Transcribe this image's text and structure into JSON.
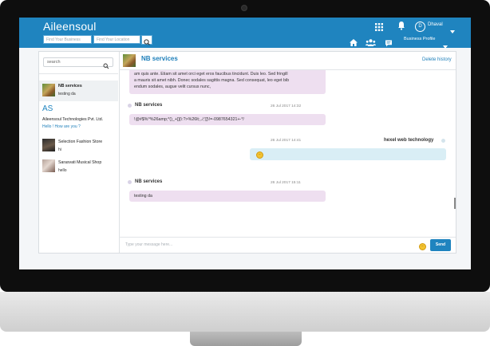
{
  "header": {
    "logo": "Aileensoul",
    "search_business_placeholder": "Find Your Business",
    "search_location_placeholder": "Find Your Location",
    "user_initial": "D",
    "user_name": "Dhaval",
    "business_profile": "Business Profile"
  },
  "sidebar": {
    "search_placeholder": "search",
    "conversations": [
      {
        "name": "NB services",
        "message": "testing da"
      },
      {
        "name": "Aileensoul Technologies Pvt. Ltd.",
        "message": "Hello ! How are you ?",
        "logo_text": "AS"
      },
      {
        "name": "Selection Fashion Store",
        "message": "hi"
      },
      {
        "name": "Sarasvati Musical Shop",
        "message": "hello"
      }
    ]
  },
  "chat": {
    "title": "NB services",
    "delete_history": "Delete history",
    "messages": [
      {
        "line1": "am quis ante. Etiam sit amet orci eget eros faucibus tincidunt. Duis leo. Sed fringill",
        "line2": "a mauris sit amet nibh. Donec sodales sagittis magna. Sed consequat, leo eget bib",
        "line3": "endum sodales, augue velit cursus nunc,"
      },
      {
        "sender": "NB services",
        "time": "26 Jul 2017 14:32",
        "text": "!@#$%^%26amp;*()_+[]{\\:?>%26lt;,./;'[]\\!=-0987654321+-*/"
      },
      {
        "sender": "hexel web technology",
        "time": "26 Jul 2017 14:41"
      },
      {
        "sender": "NB services",
        "time": "26 Jul 2017 15:11",
        "text": "testing da"
      }
    ],
    "input_placeholder": "Type your message here...",
    "send_label": "Send"
  },
  "colors": {
    "brand": "#1f84bf",
    "received_bubble": "#eedff0",
    "sent_bubble": "#d9eef5"
  }
}
